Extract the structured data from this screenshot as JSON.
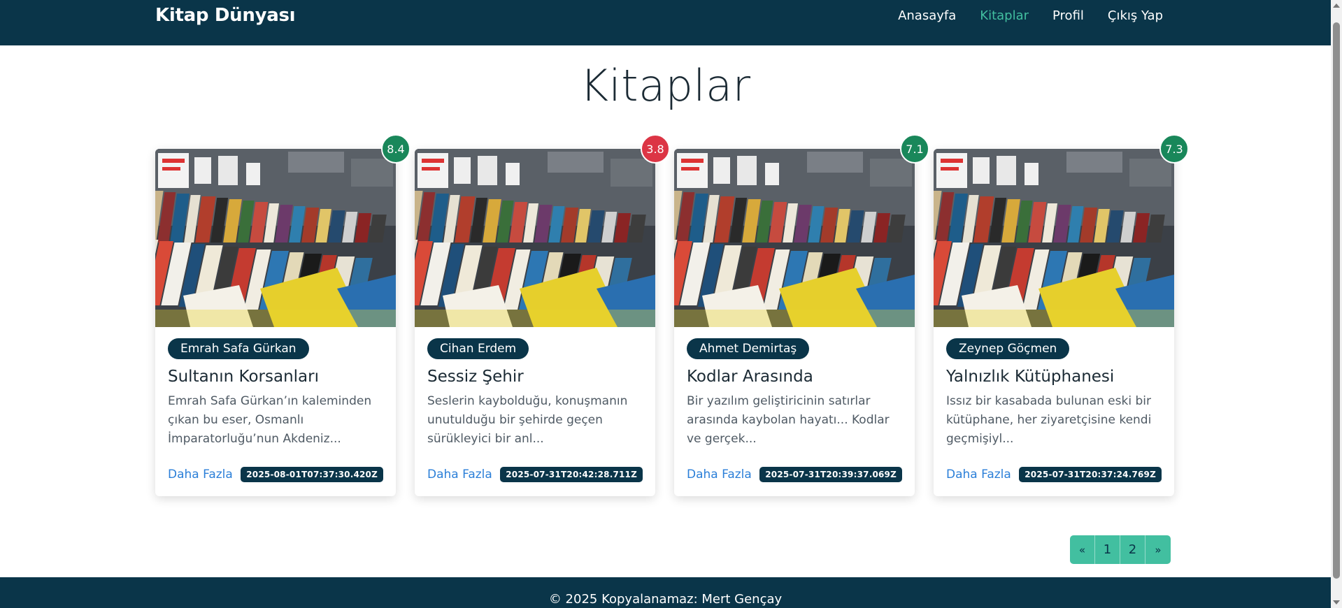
{
  "navbar": {
    "brand": "Kitap Dünyası",
    "links": [
      "Anasayfa",
      "Kitaplar",
      "Profil",
      "Çıkış Yap"
    ],
    "active_link": "Kitaplar"
  },
  "page": {
    "title": "Kitaplar"
  },
  "books": [
    {
      "rating": "8.4",
      "author": "Emrah Safa Gürkan",
      "title": "Sultanın Korsanları",
      "description": "Emrah Safa Gürkan’ın kaleminden çıkan bu eser, Osmanlı İmparatorluğu’nun Akdeniz...",
      "more": "Daha Fazla",
      "date": "2025-08-01T07:37:30.420Z"
    },
    {
      "rating": "3.8",
      "author": "Cihan Erdem",
      "title": "Sessiz Şehir",
      "description": "Seslerin kaybolduğu, konuşmanın unutulduğu bir şehirde geçen sürükleyici bir anl...",
      "more": "Daha Fazla",
      "date": "2025-07-31T20:42:28.711Z"
    },
    {
      "rating": "7.1",
      "author": "Ahmet Demirtaş",
      "title": "Kodlar Arasında",
      "description": "Bir yazılım geliştiricinin satırlar arasında kaybolan hayatı... Kodlar ve gerçek...",
      "more": "Daha Fazla",
      "date": "2025-07-31T20:39:37.069Z"
    },
    {
      "rating": "7.3",
      "author": "Zeynep Göçmen",
      "title": "Yalnızlık Kütüphanesi",
      "description": "Issız bir kasabada bulunan eski bir kütüphane, her ziyaretçisine kendi geçmişiyl...",
      "more": "Daha Fazla",
      "date": "2025-07-31T20:37:24.769Z"
    }
  ],
  "pagination": {
    "prev": "«",
    "pages": [
      "1",
      "2"
    ],
    "next": "»"
  },
  "footer": {
    "text": "© 2025 Kopyalanamaz: Mert Gençay"
  },
  "colors": {
    "navy": "#0a3549",
    "teal": "#42bfa0",
    "rating_good": "#19875a",
    "rating_bad": "#dc3545",
    "link_blue": "#2b7fd8"
  }
}
